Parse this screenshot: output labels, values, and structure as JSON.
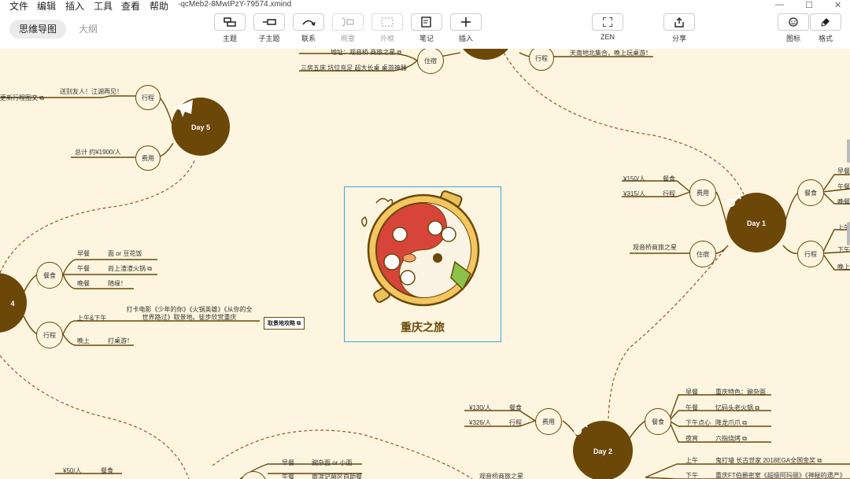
{
  "menu": [
    "文件",
    "编辑",
    "插入",
    "工具",
    "查看",
    "帮助"
  ],
  "filename": "-qcMeb2-8MwIPzY-79574.xmind",
  "window_controls": {
    "minimize": "—",
    "maximize": "☐",
    "close": "✕"
  },
  "view_tabs": {
    "mindmap": "思维导图",
    "outline": "大纲"
  },
  "toolbar": {
    "topic": "主题",
    "subtopic": "子主题",
    "relation": "联系",
    "summary": "概要",
    "boundary": "外框",
    "note": "笔记",
    "insert": "插入",
    "zen": "ZEN",
    "share": "分享",
    "icon": "图标",
    "format": "格式"
  },
  "center": {
    "title": "重庆之旅"
  },
  "day5": {
    "label": "Day 5",
    "schedule": "行程",
    "cost": "费用",
    "farewell": "送别友人！江湖再见！",
    "cut_link": "更新行程图文",
    "total": "总计 约¥1900/人"
  },
  "day4": {
    "label": "4",
    "meal": "餐食",
    "schedule": "行程",
    "breakfast": "早餐",
    "breakfast_val": "面 or 豆花饭",
    "lunch": "午餐",
    "lunch_val": "尚上渣渣火锅",
    "dinner": "晚餐",
    "dinner_val": "随缘！",
    "afternoon": "上午&下午",
    "afternoon_val": "打卡电影《少年的你》《火锅英雄》《从你的全世界路过》取景地。徒步欣赏重庆",
    "spot_box": "取景地攻略",
    "evening": "晚上",
    "evening_val": "打桌游！"
  },
  "day1": {
    "label": "Day 1",
    "cost": "费用",
    "stay": "住宿",
    "meal": "餐食",
    "schedule": "行程",
    "meal_cost": "¥150/人",
    "meal_cost_label": "餐食",
    "travel_cost": "¥315/人",
    "travel_cost_label": "行程",
    "hotel": "观音桥商旅之星",
    "breakfast_cut": "早餐",
    "lunch_cut": "午餐",
    "dinner_cut": "晚餐",
    "morning_cut": "上午",
    "afternoon_cut": "下午",
    "evening_cut": "晚上"
  },
  "top": {
    "address": "地址：观音桥 商旅之星",
    "room": "三房五床 坑位充足 超大长桌 桌游神器",
    "stay": "住宿",
    "schedule": "行程",
    "meetup": "天南地北集合，晚上玩桌游！"
  },
  "day2": {
    "label": "Day 2",
    "cost": "费用",
    "meal": "餐食",
    "meal_cost": "¥130/人",
    "meal_cost_label": "餐食",
    "travel_cost": "¥326/人",
    "travel_cost_label": "行程",
    "hotel": "观音桥商旅之星",
    "breakfast": "早餐",
    "breakfast_val": "重庆特色：豌杂面",
    "lunch": "午餐",
    "lunch_val": "忆码头老火锅",
    "snack": "下午点心",
    "snack_val": "降龙爪爪",
    "night": "夜宵",
    "night_val": "六指烧烤",
    "morning": "上午",
    "morning_val": "鬼打墙 长古世家 2018EGA全国金奖",
    "afternoon": "下午",
    "afternoon_val": "重庆FT伯爵密室《超级阿玛丽》《神秘的遗产》"
  },
  "day3": {
    "cost_val": "¥50/人",
    "cost_label": "餐食",
    "breakfast": "早餐",
    "breakfast_val": "豌杂面 or 小面",
    "lunch": "午餐",
    "lunch_val": "南滨记菌区自助餐"
  },
  "colors": {
    "brown": "#6b4708",
    "canvas": "#fdf5df",
    "dashed": "#a0522d",
    "selection": "#3aa8e0"
  },
  "icons": {
    "plane": "plane-icon",
    "key": "key-icon",
    "camera": "camera-icon",
    "link": "external-link-icon"
  }
}
